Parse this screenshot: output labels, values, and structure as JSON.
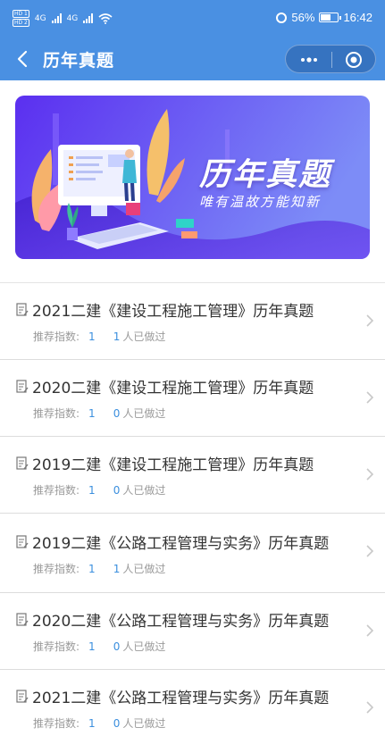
{
  "status_bar": {
    "sim1": "HD 1",
    "sim2": "HD 2",
    "net1": "4G",
    "net2": "4G",
    "battery": "56%",
    "battery_level": 0.56,
    "time": "16:42"
  },
  "nav": {
    "title": "历年真题"
  },
  "banner": {
    "title": "历年真题",
    "subtitle": "唯有温故方能知新"
  },
  "items": [
    {
      "title": "2021二建《建设工程施工管理》历年真题",
      "rec_label": "推荐指数:",
      "rec_value": "1",
      "done_count": "1",
      "done_label": "人已做过"
    },
    {
      "title": "2020二建《建设工程施工管理》历年真题",
      "rec_label": "推荐指数:",
      "rec_value": "1",
      "done_count": "0",
      "done_label": "人已做过"
    },
    {
      "title": "2019二建《建设工程施工管理》历年真题",
      "rec_label": "推荐指数:",
      "rec_value": "1",
      "done_count": "0",
      "done_label": "人已做过"
    },
    {
      "title": "2019二建《公路工程管理与实务》历年真题",
      "rec_label": "推荐指数:",
      "rec_value": "1",
      "done_count": "1",
      "done_label": "人已做过"
    },
    {
      "title": "2020二建《公路工程管理与实务》历年真题",
      "rec_label": "推荐指数:",
      "rec_value": "1",
      "done_count": "0",
      "done_label": "人已做过"
    },
    {
      "title": "2021二建《公路工程管理与实务》历年真题",
      "rec_label": "推荐指数:",
      "rec_value": "1",
      "done_count": "0",
      "done_label": "人已做过"
    }
  ],
  "colors": {
    "nav_bg": "#4a90e2",
    "accent": "#3b8fde",
    "banner_start": "#5b2ff0",
    "banner_end": "#7d8cf7"
  },
  "icons": {
    "back": "chevron-left-icon",
    "more": "more-dots-icon",
    "close": "target-icon",
    "doc": "edit-doc-icon",
    "row_arrow": "chevron-right-icon"
  }
}
